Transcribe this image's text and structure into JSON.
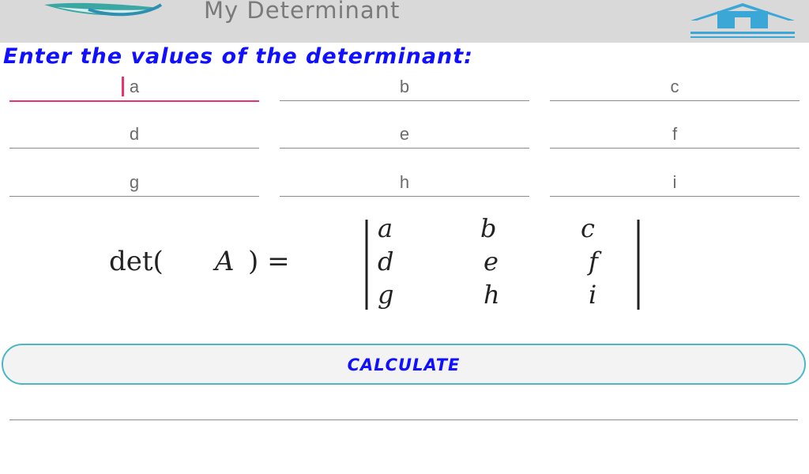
{
  "header": {
    "title": "My Determinant",
    "logo_icon": "leaf-logo",
    "home_icon": "home-icon"
  },
  "heading": "Enter the values of the determinant:",
  "fields": [
    {
      "id": "a",
      "placeholder": "a",
      "value": "",
      "focused": true
    },
    {
      "id": "b",
      "placeholder": "b",
      "value": ""
    },
    {
      "id": "c",
      "placeholder": "c",
      "value": ""
    },
    {
      "id": "d",
      "placeholder": "d",
      "value": ""
    },
    {
      "id": "e",
      "placeholder": "e",
      "value": ""
    },
    {
      "id": "f",
      "placeholder": "f",
      "value": ""
    },
    {
      "id": "g",
      "placeholder": "g",
      "value": ""
    },
    {
      "id": "h",
      "placeholder": "h",
      "value": ""
    },
    {
      "id": "i",
      "placeholder": "i",
      "value": ""
    }
  ],
  "formula": {
    "lhs": "det(",
    "variable": "A",
    "rhs": ") =",
    "matrix": [
      [
        "a",
        "b",
        "c"
      ],
      [
        "d",
        "e",
        "f"
      ],
      [
        "g",
        "h",
        "i"
      ]
    ]
  },
  "calculate_label": "CALCULATE",
  "result": "",
  "colors": {
    "accent_blue": "#1010ff",
    "focus_pink": "#e8336b",
    "button_border": "#4ab7c6",
    "header_bg": "#d9d9d9",
    "home_blue": "#3aa7d6"
  }
}
